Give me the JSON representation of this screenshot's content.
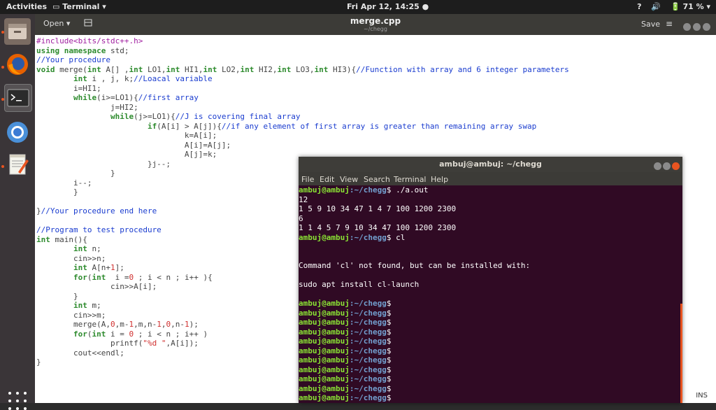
{
  "topbar": {
    "activities": "Activities",
    "app_menu": "Terminal ▾",
    "clock": "Fri Apr 12, 14:25 ●",
    "help": "?",
    "volume": "🔊",
    "battery": "🔋 71 % ▾"
  },
  "gedit": {
    "open_label": "Open ▾",
    "pin_icon": "📌",
    "title": "merge.cpp",
    "subtitle": "~/chegg",
    "save_label": "Save",
    "menu_icon": "≡",
    "status_mode": "INS",
    "code_lines": [
      [
        [
          "pp",
          "#include<bits/stdc++.h>"
        ]
      ],
      [
        [
          "kw",
          "using namespace"
        ],
        [
          "t",
          " std;"
        ]
      ],
      [
        [
          "cm",
          "//Your procedure"
        ]
      ],
      [
        [
          "kw",
          "void"
        ],
        [
          "t",
          " merge("
        ],
        [
          "kw",
          "int"
        ],
        [
          "t",
          " A[] ,"
        ],
        [
          "kw",
          "int"
        ],
        [
          "t",
          " LO1,"
        ],
        [
          "kw",
          "int"
        ],
        [
          "t",
          " HI1,"
        ],
        [
          "kw",
          "int"
        ],
        [
          "t",
          " LO2,"
        ],
        [
          "kw",
          "int"
        ],
        [
          "t",
          " HI2,"
        ],
        [
          "kw",
          "int"
        ],
        [
          "t",
          " LO3,"
        ],
        [
          "kw",
          "int"
        ],
        [
          "t",
          " HI3){"
        ],
        [
          "cm",
          "//Function with array and 6 integer parameters"
        ]
      ],
      [
        [
          "t",
          "        "
        ],
        [
          "kw",
          "int"
        ],
        [
          "t",
          " i , j, k;"
        ],
        [
          "cm",
          "//Loacal variable"
        ]
      ],
      [
        [
          "t",
          "        i=HI1;"
        ]
      ],
      [
        [
          "t",
          "        "
        ],
        [
          "kw",
          "while"
        ],
        [
          "t",
          "(i>=LO1){"
        ],
        [
          "cm",
          "//first array"
        ]
      ],
      [
        [
          "t",
          "                j=HI2;"
        ]
      ],
      [
        [
          "t",
          "                "
        ],
        [
          "kw",
          "while"
        ],
        [
          "t",
          "(j>=LO1){"
        ],
        [
          "cm",
          "//J is covering final array"
        ]
      ],
      [
        [
          "t",
          "                        "
        ],
        [
          "kw",
          "if"
        ],
        [
          "t",
          "(A[i] > A[j]){"
        ],
        [
          "cm",
          "//if any element of first array is greater than remaining array swap"
        ]
      ],
      [
        [
          "t",
          "                                k=A[i];"
        ]
      ],
      [
        [
          "t",
          "                                A[i]=A[j];"
        ]
      ],
      [
        [
          "t",
          "                                A[j]=k;"
        ]
      ],
      [
        [
          "t",
          "                        }j--;"
        ]
      ],
      [
        [
          "t",
          "                }"
        ]
      ],
      [
        [
          "t",
          "        i--;"
        ]
      ],
      [
        [
          "t",
          "        }"
        ]
      ],
      [
        [
          "t",
          ""
        ]
      ],
      [
        [
          "t",
          "}"
        ],
        [
          "cm",
          "//Your procedure end here"
        ]
      ],
      [
        [
          "t",
          ""
        ]
      ],
      [
        [
          "cm",
          "//Program to test procedure"
        ]
      ],
      [
        [
          "kw",
          "int"
        ],
        [
          "t",
          " main(){"
        ]
      ],
      [
        [
          "t",
          "        "
        ],
        [
          "kw",
          "int"
        ],
        [
          "t",
          " n;"
        ]
      ],
      [
        [
          "t",
          "        cin>>n;"
        ]
      ],
      [
        [
          "t",
          "        "
        ],
        [
          "kw",
          "int"
        ],
        [
          "t",
          " A[n+"
        ],
        [
          "num",
          "1"
        ],
        [
          "t",
          "];"
        ]
      ],
      [
        [
          "t",
          "        "
        ],
        [
          "kw",
          "for"
        ],
        [
          "t",
          "("
        ],
        [
          "kw",
          "int"
        ],
        [
          "t",
          "  i ="
        ],
        [
          "num",
          "0"
        ],
        [
          "t",
          " ; i < n ; i++ ){"
        ]
      ],
      [
        [
          "t",
          "                cin>>A[i];"
        ]
      ],
      [
        [
          "t",
          "        }"
        ]
      ],
      [
        [
          "t",
          "        "
        ],
        [
          "kw",
          "int"
        ],
        [
          "t",
          " m;"
        ]
      ],
      [
        [
          "t",
          "        cin>>m;"
        ]
      ],
      [
        [
          "t",
          "        merge(A,"
        ],
        [
          "num",
          "0"
        ],
        [
          "t",
          ",m-"
        ],
        [
          "num",
          "1"
        ],
        [
          "t",
          ",m,n-"
        ],
        [
          "num",
          "1"
        ],
        [
          "t",
          ","
        ],
        [
          "num",
          "0"
        ],
        [
          "t",
          ",n-"
        ],
        [
          "num",
          "1"
        ],
        [
          "t",
          ");"
        ]
      ],
      [
        [
          "t",
          "        "
        ],
        [
          "kw",
          "for"
        ],
        [
          "t",
          "("
        ],
        [
          "kw",
          "int"
        ],
        [
          "t",
          " i = "
        ],
        [
          "num",
          "0"
        ],
        [
          "t",
          " ; i < n ; i++ )"
        ]
      ],
      [
        [
          "t",
          "                printf("
        ],
        [
          "str",
          "\"%d \""
        ],
        [
          "t",
          ",A[i]);"
        ]
      ],
      [
        [
          "t",
          "        cout<<endl;"
        ]
      ],
      [
        [
          "t",
          "}"
        ]
      ]
    ]
  },
  "terminal": {
    "title": "ambuj@ambuj: ~/chegg",
    "menu": [
      "File",
      "Edit",
      "View",
      "Search",
      "Terminal",
      "Help"
    ],
    "prompt_user": "ambuj@ambuj",
    "prompt_dir": ":~/chegg",
    "lines": [
      {
        "prompt": true,
        "text": " ./a.out"
      },
      {
        "prompt": false,
        "text": "12"
      },
      {
        "prompt": false,
        "text": "1 5 9 10 34 47 1 4 7 100 1200 2300"
      },
      {
        "prompt": false,
        "text": "6"
      },
      {
        "prompt": false,
        "text": "1 1 4 5 7 9 10 34 47 100 1200 2300"
      },
      {
        "prompt": true,
        "text": " cl"
      },
      {
        "prompt": false,
        "text": ""
      },
      {
        "prompt": false,
        "text": ""
      },
      {
        "prompt": false,
        "text": "Command 'cl' not found, but can be installed with:"
      },
      {
        "prompt": false,
        "text": ""
      },
      {
        "prompt": false,
        "text": "sudo apt install cl-launch"
      },
      {
        "prompt": false,
        "text": ""
      },
      {
        "prompt": true,
        "text": ""
      },
      {
        "prompt": true,
        "text": ""
      },
      {
        "prompt": true,
        "text": ""
      },
      {
        "prompt": true,
        "text": ""
      },
      {
        "prompt": true,
        "text": ""
      },
      {
        "prompt": true,
        "text": ""
      },
      {
        "prompt": true,
        "text": ""
      },
      {
        "prompt": true,
        "text": ""
      },
      {
        "prompt": true,
        "text": ""
      },
      {
        "prompt": true,
        "text": ""
      },
      {
        "prompt": true,
        "text": ""
      }
    ]
  },
  "dock": {
    "items": [
      "files-icon",
      "firefox-icon",
      "terminal-icon",
      "chromium-icon",
      "text-editor-icon"
    ]
  }
}
